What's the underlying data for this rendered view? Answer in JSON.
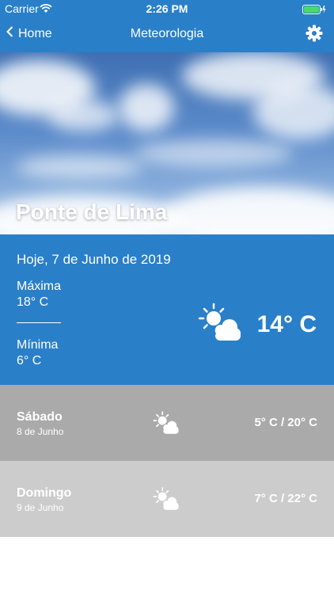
{
  "status_bar": {
    "carrier": "Carrier",
    "time": "2:26 PM"
  },
  "nav": {
    "back_label": "Home",
    "title": "Meteorologia"
  },
  "hero": {
    "city": "Ponte de Lima"
  },
  "today": {
    "date": "Hoje, 7 de Junho de 2019",
    "max_label": "Máxima",
    "max_value": "18° C",
    "min_label": "Mínima",
    "min_value": "6° C",
    "current_temp": "14° C",
    "weather_icon": "partly-cloudy-icon"
  },
  "forecast": [
    {
      "day": "Sábado",
      "date": "8 de Junho",
      "range": "5° C / 20° C",
      "weather_icon": "partly-cloudy-icon"
    },
    {
      "day": "Domingo",
      "date": "9 de Junho",
      "range": "7° C / 22° C",
      "weather_icon": "partly-cloudy-icon"
    }
  ],
  "colors": {
    "primary": "#2a7fc9",
    "row1": "#aaaaaa",
    "row2": "#cccccc"
  }
}
